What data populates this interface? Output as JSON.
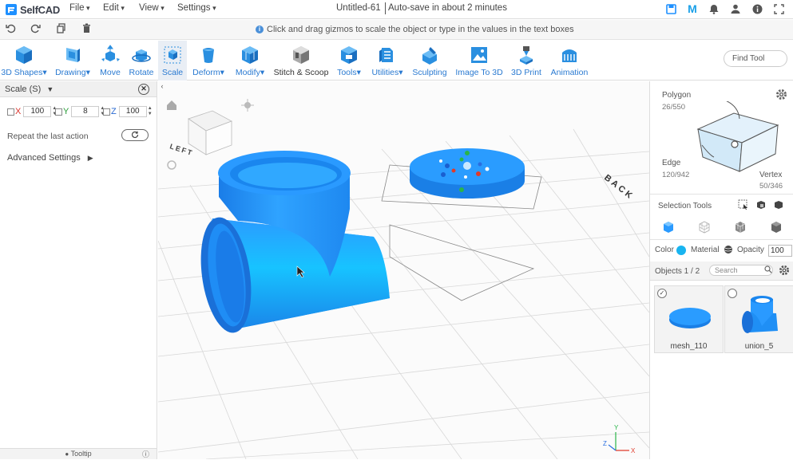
{
  "app": {
    "name": "SelfCAD",
    "title": "Untitled-61",
    "autosave": "Auto-save in about 2 minutes"
  },
  "menu": [
    "File",
    "Edit",
    "View",
    "Settings"
  ],
  "hint": "Click and drag gizmos to scale the object or type in the values in the text boxes",
  "toolbar": [
    {
      "label": "3D Shapes",
      "dropdown": true
    },
    {
      "label": "Drawing",
      "dropdown": true
    },
    {
      "label": "Move"
    },
    {
      "label": "Rotate"
    },
    {
      "label": "Scale"
    },
    {
      "label": "Deform",
      "dropdown": true
    },
    {
      "label": "Modify",
      "dropdown": true
    },
    {
      "label": "Stitch & Scoop"
    },
    {
      "label": "Tools",
      "dropdown": true
    },
    {
      "label": "Utilities",
      "dropdown": true
    },
    {
      "label": "Sculpting"
    },
    {
      "label": "Image To 3D"
    },
    {
      "label": "3D Print"
    },
    {
      "label": "Animation"
    }
  ],
  "find_tool": "Find Tool",
  "scale_panel": {
    "title": "Scale (S)",
    "x_label": "X",
    "x_value": "100",
    "y_label": "Y",
    "y_value": "8",
    "z_label": "Z",
    "z_value": "100",
    "repeat_label": "Repeat the last action",
    "advanced": "Advanced Settings",
    "tooltip": "Tooltip"
  },
  "viewport": {
    "cube_label": "LEFT",
    "back_label": "BACK",
    "axis_x": "X",
    "axis_y": "Y",
    "axis_z": "Z"
  },
  "selection": {
    "polygon_label": "Polygon",
    "polygon_count": "26/550",
    "edge_label": "Edge",
    "edge_count": "120/942",
    "vertex_label": "Vertex",
    "vertex_count": "50/346",
    "tools_label": "Selection Tools",
    "color_label": "Color",
    "material_label": "Material",
    "opacity_label": "Opacity",
    "opacity_value": "100"
  },
  "objects": {
    "header": "Objects 1 / 2",
    "search_placeholder": "Search",
    "items": [
      {
        "name": "mesh_110",
        "checked": true
      },
      {
        "name": "union_5",
        "checked": false
      }
    ]
  },
  "colors": {
    "accent": "#2a7ad1",
    "object": "#1e90ff",
    "color_swatch": "#18b4f0"
  }
}
